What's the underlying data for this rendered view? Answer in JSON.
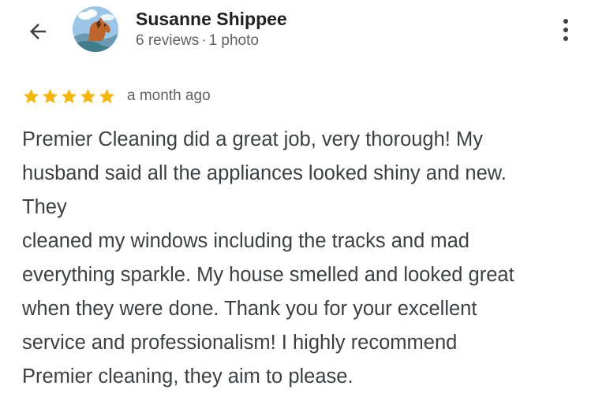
{
  "header": {
    "reviewer_name": "Susanne Shippee",
    "review_count": "6 reviews",
    "separator": "·",
    "photo_count": "1 photo"
  },
  "rating": {
    "stars": 5,
    "max_stars": 5,
    "time": "a month ago",
    "star_color": "#f4b400"
  },
  "review": {
    "text": "Premier Cleaning did a great job, very thorough! My\nhusband said all the appliances looked shiny and new.\nThey\ncleaned my windows including the tracks and mad\neverything sparkle. My house smelled and looked great\nwhen they were done. Thank you for your excellent\nservice and professionalism! I highly recommend\nPremier cleaning, they aim to please."
  },
  "icons": {
    "back": "arrow-back-icon",
    "more": "more-vert-icon",
    "star": "star-icon"
  }
}
